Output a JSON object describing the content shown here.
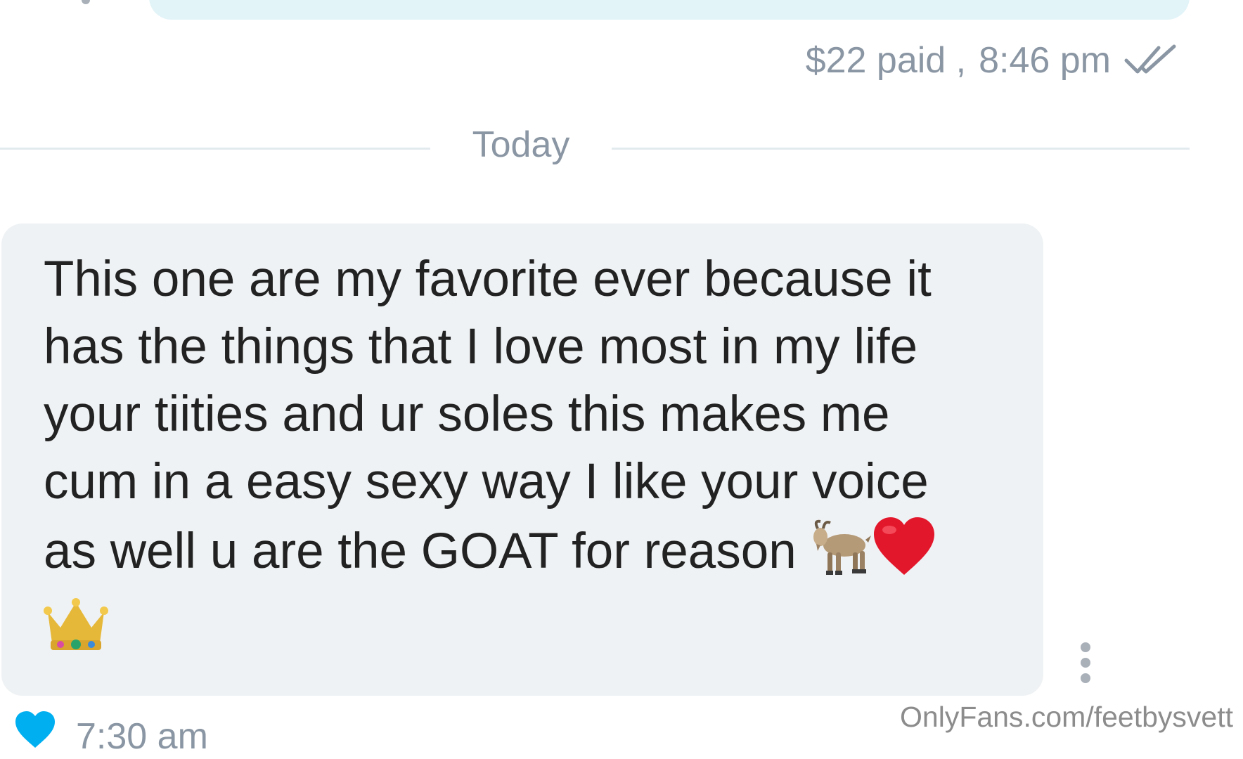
{
  "outgoing": {
    "paid_text": "$22 paid ,",
    "time": "8:46 pm",
    "status_icon": "double-check-icon"
  },
  "divider": {
    "label": "Today"
  },
  "incoming": {
    "message": "This one are my favorite ever because it\nhas the things that I love most in my life\nyour tiities and ur soles this makes me\ncum in a easy sexy way I like your voice\nas well u are the GOAT for reason",
    "emojis": [
      "goat-emoji",
      "red-heart-emoji",
      "crown-emoji"
    ],
    "time": "7:30 am",
    "like_icon": "heart-icon",
    "more_icon": "more-vertical-icon"
  },
  "watermark": {
    "text": "OnlyFans.com/feetbysvett"
  },
  "colors": {
    "incoming_bubble": "#eff2f4",
    "outgoing_bubble": "#e3f4f8",
    "meta_text": "#8a96a3",
    "like_blue": "#00aff0",
    "message_text": "#222222"
  }
}
